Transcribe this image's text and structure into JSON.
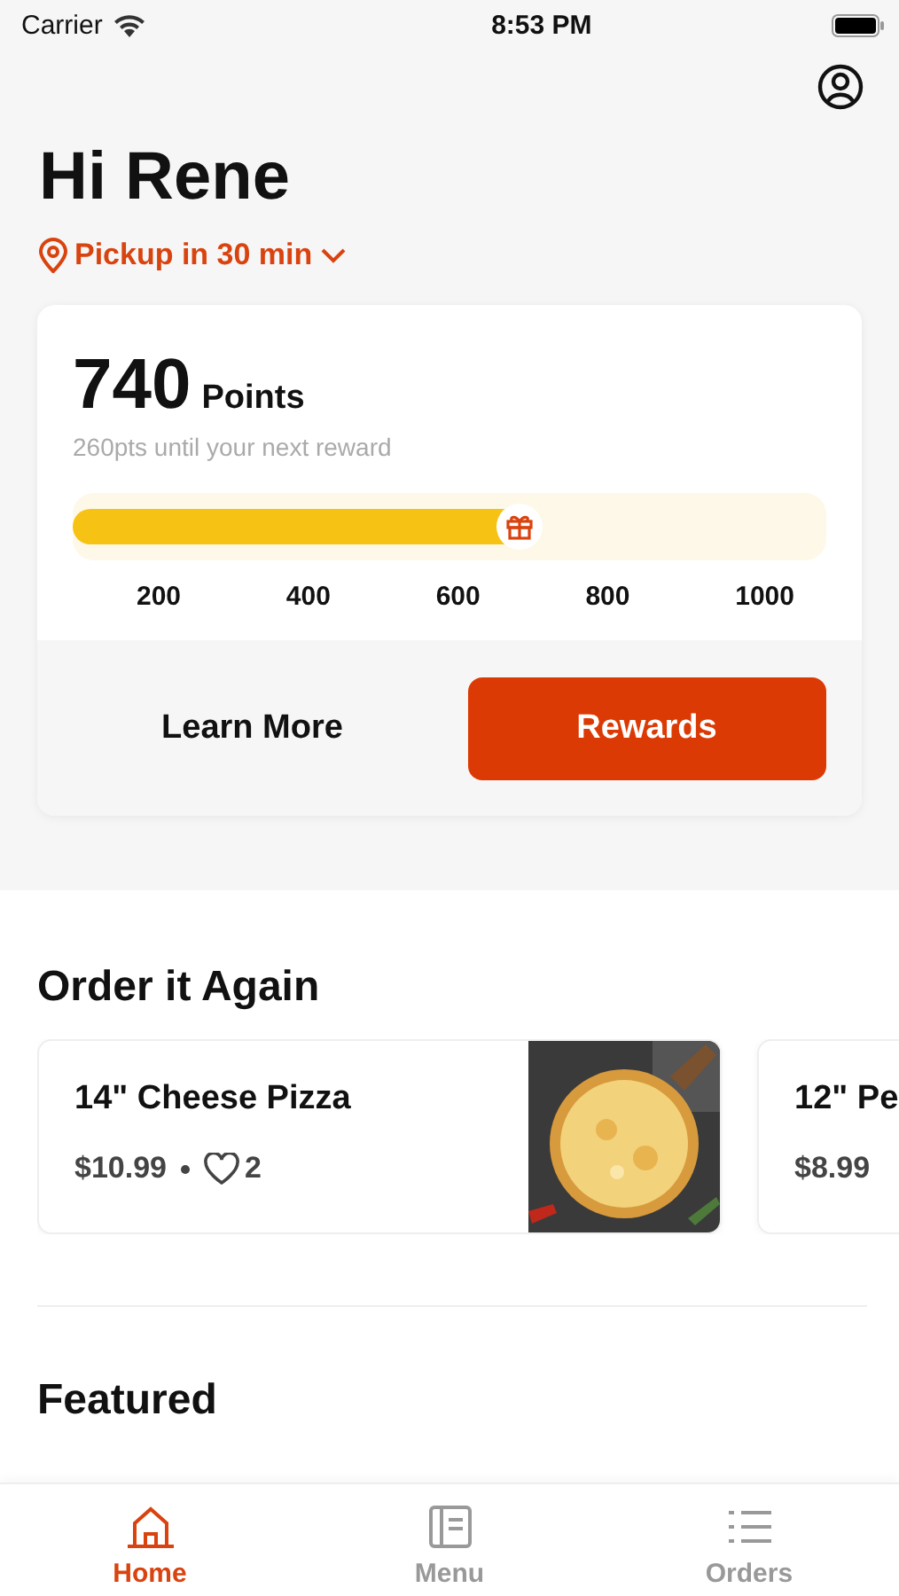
{
  "status_bar": {
    "carrier": "Carrier",
    "time": "8:53 PM"
  },
  "greeting": "Hi Rene",
  "pickup": {
    "label": "Pickup in 30 min"
  },
  "rewards": {
    "points": "740",
    "points_label": "Points",
    "subtitle": "260pts until your next reward",
    "level": 0.6,
    "ticks": [
      "200",
      "400",
      "600",
      "800",
      "1000"
    ],
    "buttons": [
      {
        "label": "Learn More",
        "kind": "plain"
      },
      {
        "label": "Rewards",
        "kind": "primary"
      }
    ]
  },
  "order_again": {
    "title": "Order it Again",
    "items": [
      {
        "name": "14\" Cheese Pizza",
        "price": "$10.99",
        "likes": "2",
        "kind": "picture"
      },
      {
        "name": "12\" Pe",
        "price": "$8.99"
      }
    ]
  },
  "featured": {
    "title": "Featured"
  },
  "tab_bar": [
    {
      "label": "Home",
      "kind": "home",
      "selected": true
    },
    {
      "label": "Menu",
      "kind": "menu",
      "selected": false
    },
    {
      "label": "Orders",
      "kind": "orders",
      "selected": false
    }
  ]
}
